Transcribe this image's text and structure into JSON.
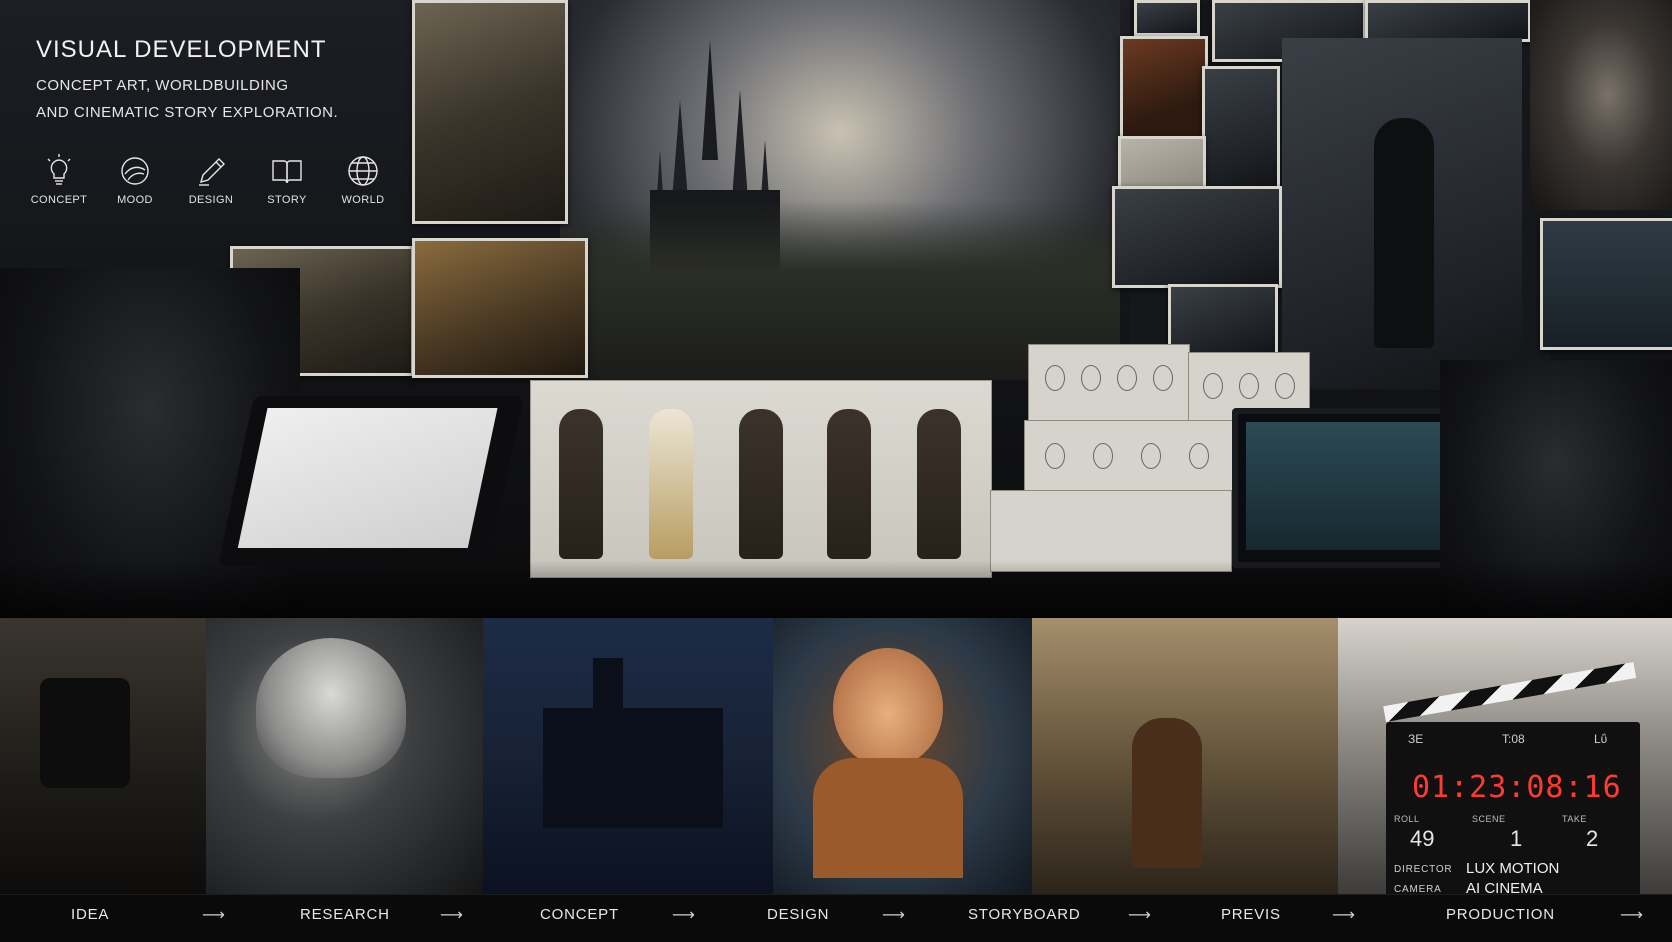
{
  "header": {
    "title": "VISUAL DEVELOPMENT",
    "subtitle_line1": "CONCEPT ART, WORLDBUILDING",
    "subtitle_line2": "AND CINEMATIC STORY EXPLORATION."
  },
  "categories": [
    {
      "label": "CONCEPT",
      "icon": "lightbulb-icon"
    },
    {
      "label": "MOOD",
      "icon": "palette-icon"
    },
    {
      "label": "DESIGN",
      "icon": "pencil-icon"
    },
    {
      "label": "STORY",
      "icon": "book-icon"
    },
    {
      "label": "WORLD",
      "icon": "globe-icon"
    }
  ],
  "clapperboard": {
    "header_left": "ЗЕ",
    "header_mid": "T:08",
    "header_right": "Lΰ",
    "timecode": "01:23:08:16",
    "roll_label": "ROLL",
    "roll": "49",
    "scene_label": "SCENE",
    "scene": "1",
    "take_label": "TAKE",
    "take": "2",
    "director_label": "DIRECTOR",
    "director": "LUX MOTION",
    "camera_label": "CAMERA",
    "camera": "AI CINEMA",
    "timecode_color": "#ff3b30"
  },
  "pipeline": {
    "steps": [
      "IDEA",
      "RESEARCH",
      "CONCEPT",
      "DESIGN",
      "STORYBOARD",
      "PREVIS",
      "PRODUCTION"
    ],
    "arrow": "⟶"
  }
}
